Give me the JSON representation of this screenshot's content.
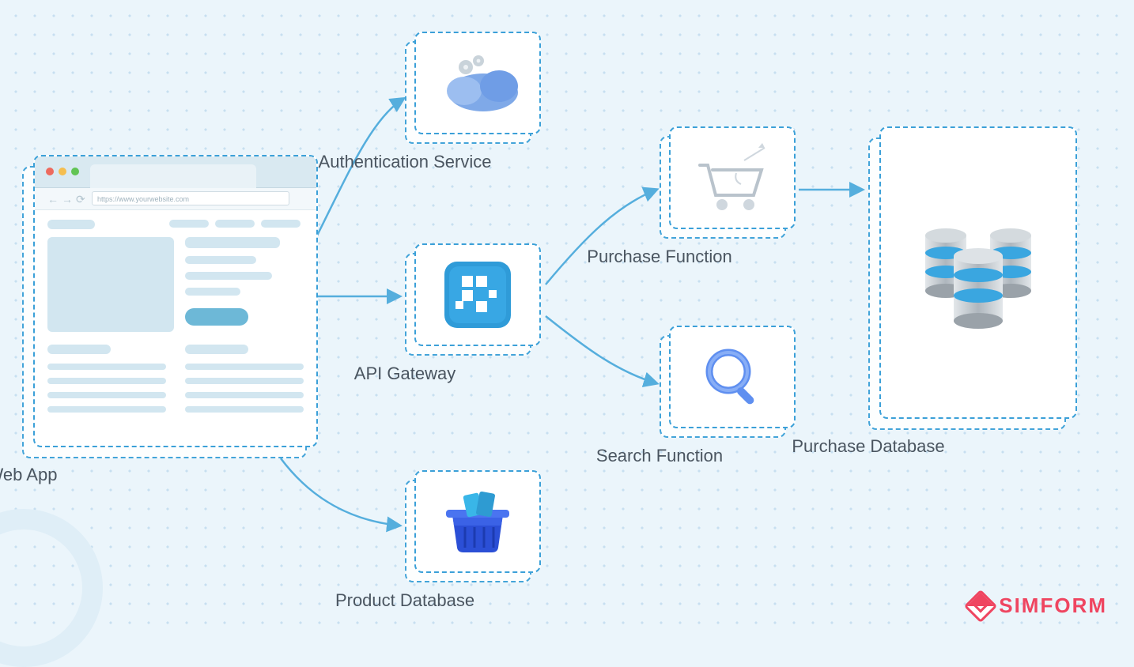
{
  "nodes": {
    "web_app": {
      "label": "Web App",
      "url_placeholder": "https://www.yourwebsite.com"
    },
    "auth": {
      "label": "Authentication Service"
    },
    "api": {
      "label": "API Gateway"
    },
    "product": {
      "label": "Product Database"
    },
    "purchase_fn": {
      "label": "Purchase Function"
    },
    "search_fn": {
      "label": "Search Function"
    },
    "purchase_db": {
      "label": "Purchase Database"
    }
  },
  "brand": {
    "name": "SIMFORM"
  },
  "edges": [
    [
      "web_app",
      "auth"
    ],
    [
      "web_app",
      "api"
    ],
    [
      "web_app",
      "product"
    ],
    [
      "api",
      "purchase_fn"
    ],
    [
      "api",
      "search_fn"
    ],
    [
      "purchase_fn",
      "purchase_db"
    ]
  ]
}
